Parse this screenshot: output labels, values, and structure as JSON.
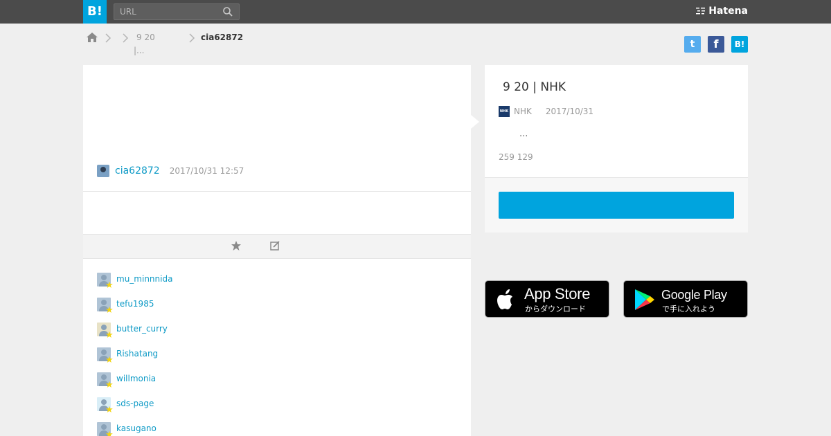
{
  "header": {
    "logo_text": "B!",
    "search_placeholder": "URL",
    "brand": "Hatena"
  },
  "breadcrumb": {
    "item1_line1": "9 20",
    "item1_line2": "|...",
    "current": "cia62872"
  },
  "share": {
    "twitter_glyph": "t",
    "facebook_glyph": "f",
    "hatena_glyph": "B!"
  },
  "comment": {
    "author": "cia62872",
    "timestamp": "2017/10/31 12:57"
  },
  "stars": [
    {
      "user": "mu_minnnida"
    },
    {
      "user": "tefu1985"
    },
    {
      "user": "butter_curry"
    },
    {
      "user": "Rishatang"
    },
    {
      "user": "willmonia"
    },
    {
      "user": "sds-page"
    },
    {
      "user": "kasugano"
    }
  ],
  "entry": {
    "title": "9 20 | NHK",
    "site_icon_text": "NHK",
    "site": "NHK",
    "date": "2017/10/31",
    "description": "...",
    "counts": "259 129"
  },
  "apps": {
    "appstore_title": "App Store",
    "appstore_sub": "からダウンロード",
    "googleplay_title": "Google Play",
    "googleplay_sub": "で手に入れよう"
  },
  "colors": {
    "accent": "#00a4de",
    "topbar": "#4b4b4b",
    "link": "#0e9ac6",
    "star": "#f3d511"
  }
}
